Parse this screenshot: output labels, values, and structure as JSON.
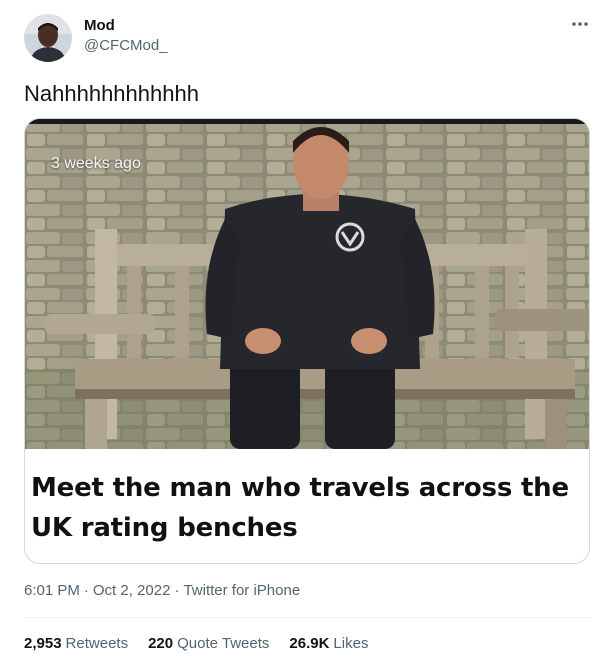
{
  "author": {
    "display_name": "Mod",
    "handle": "@CFCMod_",
    "avatar_icon": "user-avatar"
  },
  "tweet": {
    "text": "Nahhhhhhhhhhhh",
    "more_icon": "more-horizontal-icon"
  },
  "media": {
    "overlay_timestamp": "3 weeks ago",
    "headline": "Meet the man who travels across the UK rating benches"
  },
  "meta": {
    "time": "6:01 PM",
    "separator": "·",
    "date": "Oct 2, 2022",
    "source": "Twitter for iPhone"
  },
  "stats": {
    "retweets_count": "2,953",
    "retweets_label": "Retweets",
    "quotes_count": "220",
    "quotes_label": "Quote Tweets",
    "likes_count": "26.9K",
    "likes_label": "Likes"
  },
  "colors": {
    "text_primary": "#0f1419",
    "text_secondary": "#536471",
    "border": "#cfd9de"
  }
}
